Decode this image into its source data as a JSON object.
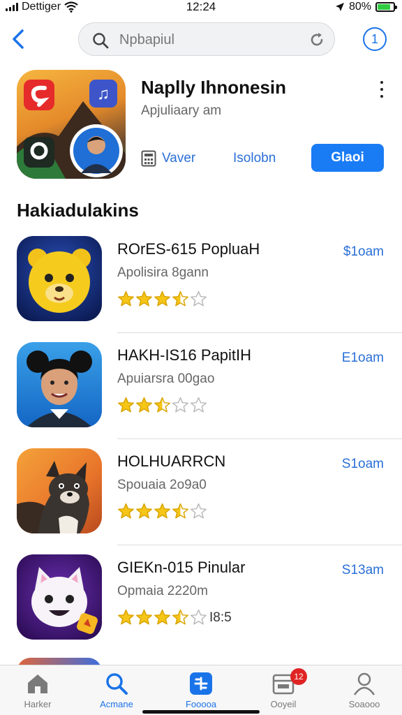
{
  "status_bar": {
    "carrier": "Dettiger",
    "time": "12:24",
    "battery_percent": "80%",
    "battery_level": 0.8,
    "icons": [
      "signal-icon",
      "wifi-icon",
      "location-arrow-icon",
      "battery-icon"
    ]
  },
  "search": {
    "value": "Npbapiul"
  },
  "info_button": {
    "label": "1"
  },
  "featured": {
    "title": "Naplly Ihnonesin",
    "subtitle": "Apjuliaary am",
    "view_label": "Vaver",
    "link_label": "Isolobn",
    "get_label": "Glaoi"
  },
  "section": {
    "title": "Hakiadulakins"
  },
  "apps": [
    {
      "name": "ROrES-615 PopluaH",
      "subtitle": "Apolisira 8gann",
      "rating": 3.5,
      "price": "$1oam",
      "extra": ""
    },
    {
      "name": "HAKH-IS16 PapitIH",
      "subtitle": "Apuiarsra 00gao",
      "rating": 2.5,
      "price": "E1oam",
      "extra": ""
    },
    {
      "name": "HOLHUARRCN",
      "subtitle": "Spouaia 2o9a0",
      "rating": 3.5,
      "price": "S1oam",
      "extra": ""
    },
    {
      "name": "GIEKn-015 Pinular",
      "subtitle": "Opmaia 2220m",
      "rating": 3.5,
      "price": "S13am",
      "extra": "I8:5"
    }
  ],
  "tabs": [
    {
      "label": "Harker",
      "icon": "home-icon",
      "active": false
    },
    {
      "label": "Acmane",
      "icon": "search-icon",
      "active": true
    },
    {
      "label": "Fooooa",
      "icon": "apps-icon",
      "active": true
    },
    {
      "label": "Ooyeil",
      "icon": "updates-icon",
      "active": false,
      "badge": "12"
    },
    {
      "label": "Soaooo",
      "icon": "profile-icon",
      "active": false
    }
  ],
  "colors": {
    "accent": "#1a73e8",
    "button": "#1a7cf5",
    "star": "#f5c518",
    "badge": "#e02424"
  }
}
